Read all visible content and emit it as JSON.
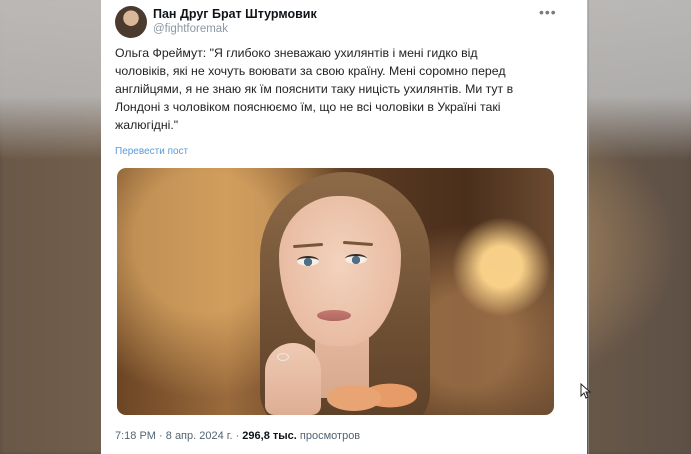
{
  "tweet": {
    "author_name": "Пан Друг Брат Штурмовик",
    "author_handle": "@fightforemak",
    "more_icon": "more-dots-icon",
    "text": "Ольга Фреймут: \"Я глибоко зневажаю ухилянтів і мені гидко від\nчоловіків, які не хочуть воювати за свою країну. Мені соромно перед\nанглійцями, я не знаю як їм пояснити таку ницість ухилянтів. Ми тут в\nЛондоні з чоловіком пояснюємо їм, що не всі чоловіки в Україні такі\nжалюгідні.\"",
    "translate_link": "Перевести пост",
    "time": "7:18 PM",
    "date": "8 апр. 2024 г.",
    "separator": "·",
    "views_count": "296,8 тыс.",
    "views_label": "просмотров"
  },
  "colors": {
    "link": "#5b9bd5",
    "secondary_text": "#536471",
    "primary_text": "#0f1419"
  }
}
